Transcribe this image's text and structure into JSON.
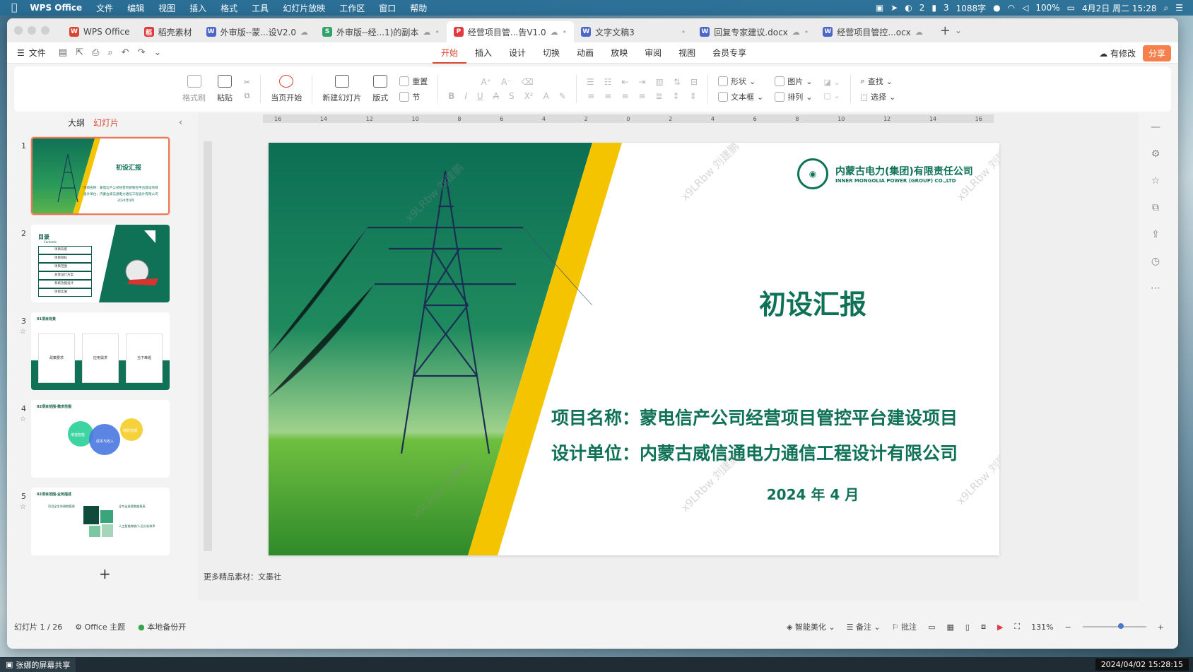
{
  "menubar": {
    "app": "WPS Office",
    "items": [
      "文件",
      "编辑",
      "视图",
      "插入",
      "格式",
      "工具",
      "幻灯片放映",
      "工作区",
      "窗口",
      "帮助"
    ],
    "status": {
      "wechat_count": "2",
      "signal": "3",
      "net": "1088字",
      "battery": "100%",
      "datetime": "4月2日 周二 15:28"
    }
  },
  "tabs": [
    {
      "label": "WPS Office",
      "color": "#d8462f",
      "glyph": "W"
    },
    {
      "label": "稻壳素材",
      "color": "#e0393e",
      "glyph": "稻"
    },
    {
      "label": "外审版--蒙...设V2.0",
      "color": "#4a66c8",
      "glyph": "W"
    },
    {
      "label": "外审版--经...1)的副本",
      "color": "#2fa36a",
      "glyph": "S"
    },
    {
      "label": "经营项目管...告V1.0",
      "color": "#e0393e",
      "glyph": "P"
    },
    {
      "label": "文字文稿3",
      "color": "#4a66c8",
      "glyph": "W"
    },
    {
      "label": "回复专家建议.docx",
      "color": "#4a66c8",
      "glyph": "W"
    },
    {
      "label": "经营项目管控...ocx",
      "color": "#4a66c8",
      "glyph": "W"
    }
  ],
  "ribbon": {
    "file": "文件",
    "tabs": [
      "开始",
      "插入",
      "设计",
      "切换",
      "动画",
      "放映",
      "审阅",
      "视图",
      "会员专享"
    ],
    "active_tab": "开始",
    "has_changes": "有修改",
    "share": "分享",
    "tools": {
      "format_painter": "格式刷",
      "paste": "粘贴",
      "play_from_current": "当页开始",
      "new_slide": "新建幻灯片",
      "layout": "版式",
      "reset": "重置",
      "section": "节",
      "shape": "形状",
      "picture": "图片",
      "textbox": "文本框",
      "arrange": "排列",
      "find": "查找",
      "select": "选择"
    }
  },
  "panel": {
    "outline_tab": "大纲",
    "slides_tab": "幻灯片",
    "thumbs": [
      {
        "num": "1",
        "title": "初设汇报",
        "line1": "项目名称：蒙电信产公司经营项目管控平台建设项目",
        "line2": "设计单位：内蒙古威信通电力通信工程设计有限公司",
        "date": "2024年4月"
      },
      {
        "num": "2",
        "title": "目录",
        "subtitle": "Contents",
        "items": [
          "项目背景",
          "项目目标",
          "项目范围",
          "总体设计方案",
          "系统功能设计",
          "项目实施"
        ]
      },
      {
        "num": "3",
        "title": "01项目背景",
        "items": [
          "政策要求",
          "应用需求",
          "当下难题"
        ]
      },
      {
        "num": "4",
        "title": "02项目范围-需求范围",
        "items": [
          "增值智能",
          "增收管理",
          "成本与收入"
        ]
      },
      {
        "num": "5",
        "title": "02项目范围-业务描述",
        "items": [
          "项目全生命周期管理",
          "全专业经营数据报表",
          "人工智能增收/人员分析效率"
        ]
      }
    ]
  },
  "slide": {
    "company_cn": "内蒙古电力(集团)有限责任公司",
    "company_en": "INNER MONGOLIA POWER (GROUP) CO.,LTD",
    "title": "初设汇报",
    "project_line": "项目名称：蒙电信产公司经营项目管控平台建设项目",
    "designer_line": "设计单位：内蒙古威信通电力通信工程设计有限公司",
    "date": "2024 年 4 月",
    "watermark": "x9LRbw 刘建鹏"
  },
  "notes_text": "更多精品素材：文墨社",
  "statusbar": {
    "slide_counter": "幻灯片 1 / 26",
    "theme": "Office 主题",
    "backup": "本地备份开",
    "beautify": "智能美化",
    "notes": "备注",
    "comments": "批注",
    "zoom": "131%"
  },
  "taskbar": {
    "sharing": "张娜的屏幕共享",
    "timestamp": "2024/04/02 15:28:15"
  },
  "colors": {
    "accent": "#d8462f",
    "slide_green": "#0f7256",
    "slide_yellow": "#f5c400"
  }
}
